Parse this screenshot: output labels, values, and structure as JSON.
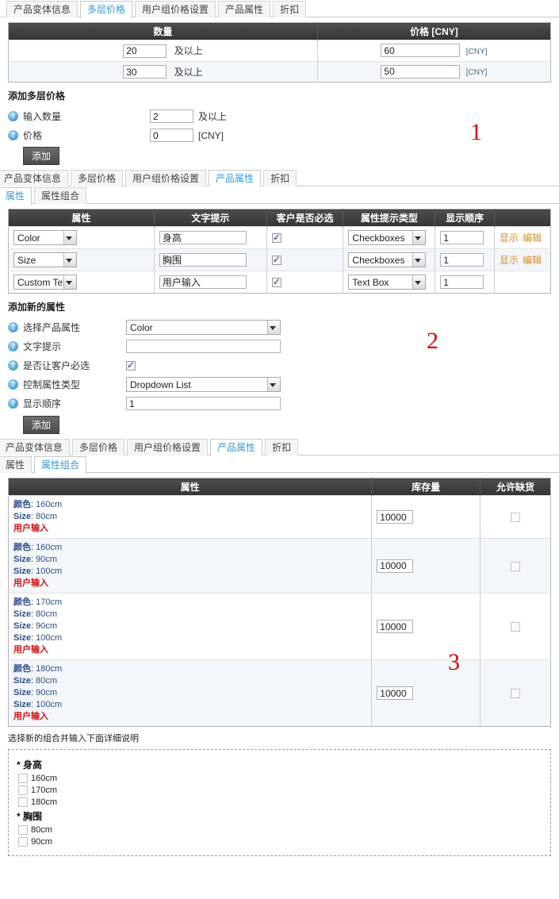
{
  "main_tabs": [
    {
      "label": "产品变体信息",
      "active": false
    },
    {
      "label": "多层价格",
      "active": true
    },
    {
      "label": "用户组价格设置",
      "active": false
    },
    {
      "label": "产品属性",
      "active": false
    },
    {
      "label": "折扣",
      "active": false
    }
  ],
  "tier_price": {
    "headers": [
      "数量",
      "价格 [CNY]"
    ],
    "currency_suffix": "[CNY]",
    "and_above": "及以上",
    "rows": [
      {
        "qty": "20",
        "qty_suffix": "及以上",
        "price": "60",
        "price_unit": "[CNY]"
      },
      {
        "qty": "30",
        "qty_suffix": "及以上",
        "price": "50",
        "price_unit": "[CNY]"
      }
    ],
    "add_section_title": "添加多层价格",
    "fields": [
      {
        "label": "输入数量",
        "value": "2",
        "suffix": "及以上"
      },
      {
        "label": "价格",
        "value": "0",
        "suffix": "[CNY]"
      }
    ],
    "add_button": "添加"
  },
  "attr_tabs": [
    {
      "label": "产品变体信息",
      "active": false
    },
    {
      "label": "多层价格",
      "active": false
    },
    {
      "label": "用户组价格设置",
      "active": false
    },
    {
      "label": "产品属性",
      "active": true
    },
    {
      "label": "折扣",
      "active": false
    }
  ],
  "attr_subtabs_1": [
    {
      "label": "属性",
      "active": true
    },
    {
      "label": "属性组合",
      "active": false
    }
  ],
  "attr_table": {
    "headers": [
      "属性",
      "文字提示",
      "客户是否必选",
      "属性提示类型",
      "显示顺序",
      ""
    ],
    "rows": [
      {
        "attribute": "Color",
        "tip": "身高",
        "required": true,
        "control_type": "Checkboxes",
        "order": "1",
        "links": [
          "显示",
          "编辑"
        ]
      },
      {
        "attribute": "Size",
        "tip": "胸围",
        "required": true,
        "control_type": "Checkboxes",
        "order": "1",
        "links": [
          "显示",
          "编辑"
        ]
      },
      {
        "attribute": "Custom Text",
        "tip": "用户输入",
        "required": true,
        "control_type": "Text Box",
        "order": "1",
        "links": []
      }
    ]
  },
  "add_attr": {
    "title": "添加新的属性",
    "fields": [
      {
        "label": "选择产品属性",
        "type": "select",
        "value": "Color"
      },
      {
        "label": "文字提示",
        "type": "text",
        "value": ""
      },
      {
        "label": "是否让客户必选",
        "type": "checkbox",
        "checked": true
      },
      {
        "label": "控制属性类型",
        "type": "select",
        "value": "Dropdown List"
      },
      {
        "label": "显示顺序",
        "type": "text",
        "value": "1"
      }
    ],
    "add_button": "添加"
  },
  "combo_tabs": [
    {
      "label": "产品变体信息",
      "active": false
    },
    {
      "label": "多层价格",
      "active": false
    },
    {
      "label": "用户组价格设置",
      "active": false
    },
    {
      "label": "产品属性",
      "active": true
    },
    {
      "label": "折扣",
      "active": false
    }
  ],
  "attr_subtabs_2": [
    {
      "label": "属性",
      "active": false
    },
    {
      "label": "属性组合",
      "active": true
    }
  ],
  "combo_table": {
    "headers": [
      "属性",
      "库存量",
      "允许缺货"
    ],
    "rows": [
      {
        "attrs": [
          {
            "key": "颜色",
            "val": "160cm"
          },
          {
            "key": "Size",
            "val": "80cm"
          }
        ],
        "note": "用户输入",
        "stock": "10000",
        "allow_backorder": false
      },
      {
        "attrs": [
          {
            "key": "颜色",
            "val": "160cm"
          },
          {
            "key": "Size",
            "val": "90cm"
          },
          {
            "key": "Size",
            "val": "100cm"
          }
        ],
        "note": "用户输入",
        "stock": "10000",
        "allow_backorder": false
      },
      {
        "attrs": [
          {
            "key": "颜色",
            "val": "170cm"
          },
          {
            "key": "Size",
            "val": "80cm"
          },
          {
            "key": "Size",
            "val": "90cm"
          },
          {
            "key": "Size",
            "val": "100cm"
          }
        ],
        "note": "用户输入",
        "stock": "10000",
        "allow_backorder": false
      },
      {
        "attrs": [
          {
            "key": "颜色",
            "val": "180cm"
          },
          {
            "key": "Size",
            "val": "80cm"
          },
          {
            "key": "Size",
            "val": "90cm"
          },
          {
            "key": "Size",
            "val": "100cm"
          }
        ],
        "note": "用户输入",
        "stock": "10000",
        "allow_backorder": false
      }
    ]
  },
  "new_combo": {
    "hint": "选择新的组合并输入下面详细说明",
    "groups": [
      {
        "star": "*",
        "name": "身高",
        "options": [
          {
            "label": "160cm",
            "checked": false
          },
          {
            "label": "170cm",
            "checked": false
          },
          {
            "label": "180cm",
            "checked": false
          }
        ]
      },
      {
        "star": "*",
        "name": "胸围",
        "options": [
          {
            "label": "80cm",
            "checked": false
          },
          {
            "label": "90cm",
            "checked": false
          }
        ]
      }
    ]
  },
  "markers": {
    "one": "1",
    "two": "2",
    "three": "3",
    "color": "#e00000"
  }
}
